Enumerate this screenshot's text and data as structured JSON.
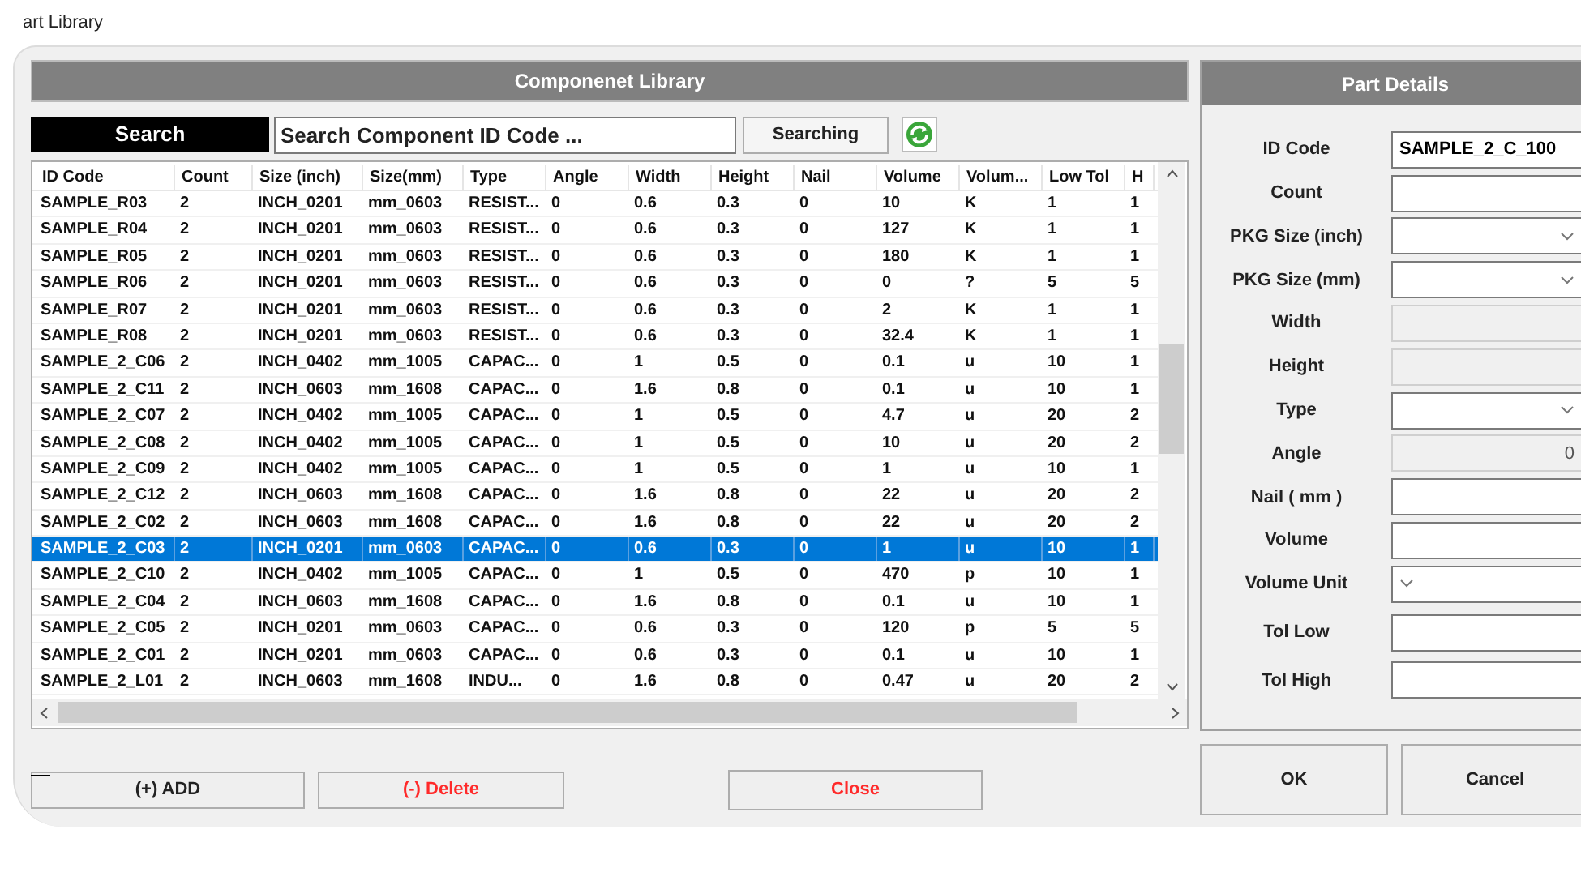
{
  "window": {
    "title": "art Library"
  },
  "library": {
    "title": "Componenet Library",
    "search_label": "Search",
    "search": {
      "placeholder": "Search Component ID Code ..."
    },
    "search_button": "Searching",
    "table": {
      "columns": [
        "ID Code",
        "Count",
        "Size (inch)",
        "Size(mm)",
        "Type",
        "Angle",
        "Width",
        "Height",
        "Nail",
        "Volume",
        "Volum...",
        "Low Tol",
        "H"
      ],
      "rows": [
        {
          "cells": [
            "SAMPLE_R03",
            "2",
            "INCH_0201",
            "mm_0603",
            "RESIST...",
            "0",
            "0.6",
            "0.3",
            "0",
            "10",
            "K",
            "1",
            "1"
          ],
          "selected": false
        },
        {
          "cells": [
            "SAMPLE_R04",
            "2",
            "INCH_0201",
            "mm_0603",
            "RESIST...",
            "0",
            "0.6",
            "0.3",
            "0",
            "127",
            "K",
            "1",
            "1"
          ],
          "selected": false
        },
        {
          "cells": [
            "SAMPLE_R05",
            "2",
            "INCH_0201",
            "mm_0603",
            "RESIST...",
            "0",
            "0.6",
            "0.3",
            "0",
            "180",
            "K",
            "1",
            "1"
          ],
          "selected": false
        },
        {
          "cells": [
            "SAMPLE_R06",
            "2",
            "INCH_0201",
            "mm_0603",
            "RESIST...",
            "0",
            "0.6",
            "0.3",
            "0",
            "0",
            "?",
            "5",
            "5"
          ],
          "selected": false
        },
        {
          "cells": [
            "SAMPLE_R07",
            "2",
            "INCH_0201",
            "mm_0603",
            "RESIST...",
            "0",
            "0.6",
            "0.3",
            "0",
            "2",
            "K",
            "1",
            "1"
          ],
          "selected": false
        },
        {
          "cells": [
            "SAMPLE_R08",
            "2",
            "INCH_0201",
            "mm_0603",
            "RESIST...",
            "0",
            "0.6",
            "0.3",
            "0",
            "32.4",
            "K",
            "1",
            "1"
          ],
          "selected": false
        },
        {
          "cells": [
            "SAMPLE_2_C06",
            "2",
            "INCH_0402",
            "mm_1005",
            "CAPAC...",
            "0",
            "1",
            "0.5",
            "0",
            "0.1",
            "u",
            "10",
            "1"
          ],
          "selected": false
        },
        {
          "cells": [
            "SAMPLE_2_C11",
            "2",
            "INCH_0603",
            "mm_1608",
            "CAPAC...",
            "0",
            "1.6",
            "0.8",
            "0",
            "0.1",
            "u",
            "10",
            "1"
          ],
          "selected": false
        },
        {
          "cells": [
            "SAMPLE_2_C07",
            "2",
            "INCH_0402",
            "mm_1005",
            "CAPAC...",
            "0",
            "1",
            "0.5",
            "0",
            "4.7",
            "u",
            "20",
            "2"
          ],
          "selected": false
        },
        {
          "cells": [
            "SAMPLE_2_C08",
            "2",
            "INCH_0402",
            "mm_1005",
            "CAPAC...",
            "0",
            "1",
            "0.5",
            "0",
            "10",
            "u",
            "20",
            "2"
          ],
          "selected": false
        },
        {
          "cells": [
            "SAMPLE_2_C09",
            "2",
            "INCH_0402",
            "mm_1005",
            "CAPAC...",
            "0",
            "1",
            "0.5",
            "0",
            "1",
            "u",
            "10",
            "1"
          ],
          "selected": false
        },
        {
          "cells": [
            "SAMPLE_2_C12",
            "2",
            "INCH_0603",
            "mm_1608",
            "CAPAC...",
            "0",
            "1.6",
            "0.8",
            "0",
            "22",
            "u",
            "20",
            "2"
          ],
          "selected": false
        },
        {
          "cells": [
            "SAMPLE_2_C02",
            "2",
            "INCH_0603",
            "mm_1608",
            "CAPAC...",
            "0",
            "1.6",
            "0.8",
            "0",
            "22",
            "u",
            "20",
            "2"
          ],
          "selected": false
        },
        {
          "cells": [
            "SAMPLE_2_C03",
            "2",
            "INCH_0201",
            "mm_0603",
            "CAPAC...",
            "0",
            "0.6",
            "0.3",
            "0",
            "1",
            "u",
            "10",
            "1"
          ],
          "selected": true
        },
        {
          "cells": [
            "SAMPLE_2_C10",
            "2",
            "INCH_0402",
            "mm_1005",
            "CAPAC...",
            "0",
            "1",
            "0.5",
            "0",
            "470",
            "p",
            "10",
            "1"
          ],
          "selected": false
        },
        {
          "cells": [
            "SAMPLE_2_C04",
            "2",
            "INCH_0603",
            "mm_1608",
            "CAPAC...",
            "0",
            "1.6",
            "0.8",
            "0",
            "0.1",
            "u",
            "10",
            "1"
          ],
          "selected": false
        },
        {
          "cells": [
            "SAMPLE_2_C05",
            "2",
            "INCH_0201",
            "mm_0603",
            "CAPAC...",
            "0",
            "0.6",
            "0.3",
            "0",
            "120",
            "p",
            "5",
            "5"
          ],
          "selected": false
        },
        {
          "cells": [
            "SAMPLE_2_C01",
            "2",
            "INCH_0201",
            "mm_0603",
            "CAPAC...",
            "0",
            "0.6",
            "0.3",
            "0",
            "0.1",
            "u",
            "10",
            "1"
          ],
          "selected": false
        },
        {
          "cells": [
            "SAMPLE_2_L01",
            "2",
            "INCH_0603",
            "mm_1608",
            "INDU...",
            "0",
            "1.6",
            "0.8",
            "0",
            "0.47",
            "u",
            "20",
            "2"
          ],
          "selected": false
        }
      ]
    },
    "buttons": [
      {
        "label": "(+) ADD",
        "kind": "normal"
      },
      {
        "label": "(-) Delete",
        "kind": "danger"
      },
      {
        "label": "Close",
        "kind": "danger"
      }
    ]
  },
  "details": {
    "title": "Part Details",
    "fields": [
      {
        "label": "ID Code",
        "kind": "text",
        "value": "SAMPLE_2_C_100"
      },
      {
        "label": "Count",
        "kind": "text"
      },
      {
        "label": "PKG Size (inch)",
        "kind": "dropdown"
      },
      {
        "label": "PKG Size (mm)",
        "kind": "dropdown"
      },
      {
        "label": "Width",
        "kind": "readonly"
      },
      {
        "label": "Height",
        "kind": "readonly"
      },
      {
        "label": "Type",
        "kind": "dropdown"
      },
      {
        "label": "Angle",
        "kind": "readonly",
        "value": "0"
      },
      {
        "label": "Nail ( mm )",
        "kind": "text"
      },
      {
        "label": "Volume",
        "kind": "text"
      },
      {
        "label": "Volume Unit",
        "kind": "unit"
      },
      {
        "label": "Tol Low",
        "kind": "text"
      },
      {
        "label": "Tol High",
        "kind": "text"
      }
    ],
    "buttons": [
      "OK",
      "Cancel"
    ]
  }
}
